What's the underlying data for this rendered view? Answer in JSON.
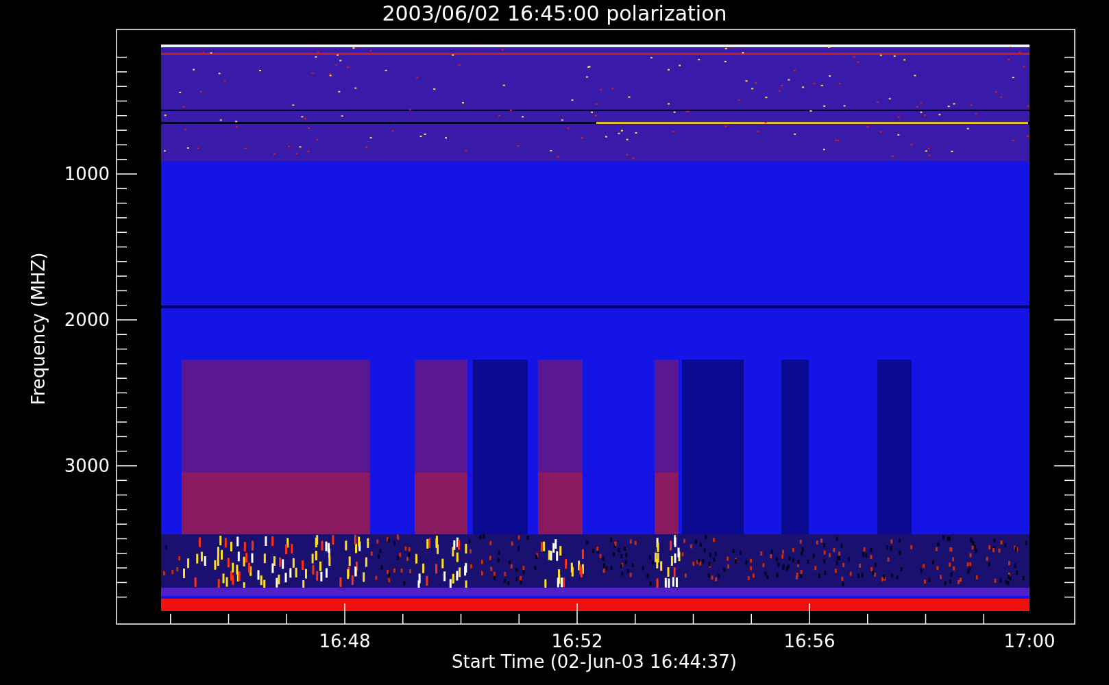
{
  "title": "2003/06/02 16:45:00 polarization",
  "y_axis": {
    "label": "Frequency (MHZ)",
    "ticks": [
      "1000",
      "2000",
      "3000"
    ]
  },
  "x_axis": {
    "label": "Start Time (02-Jun-03 16:44:37)",
    "ticks": [
      "16:48",
      "16:52",
      "16:56",
      "17:00"
    ]
  }
}
